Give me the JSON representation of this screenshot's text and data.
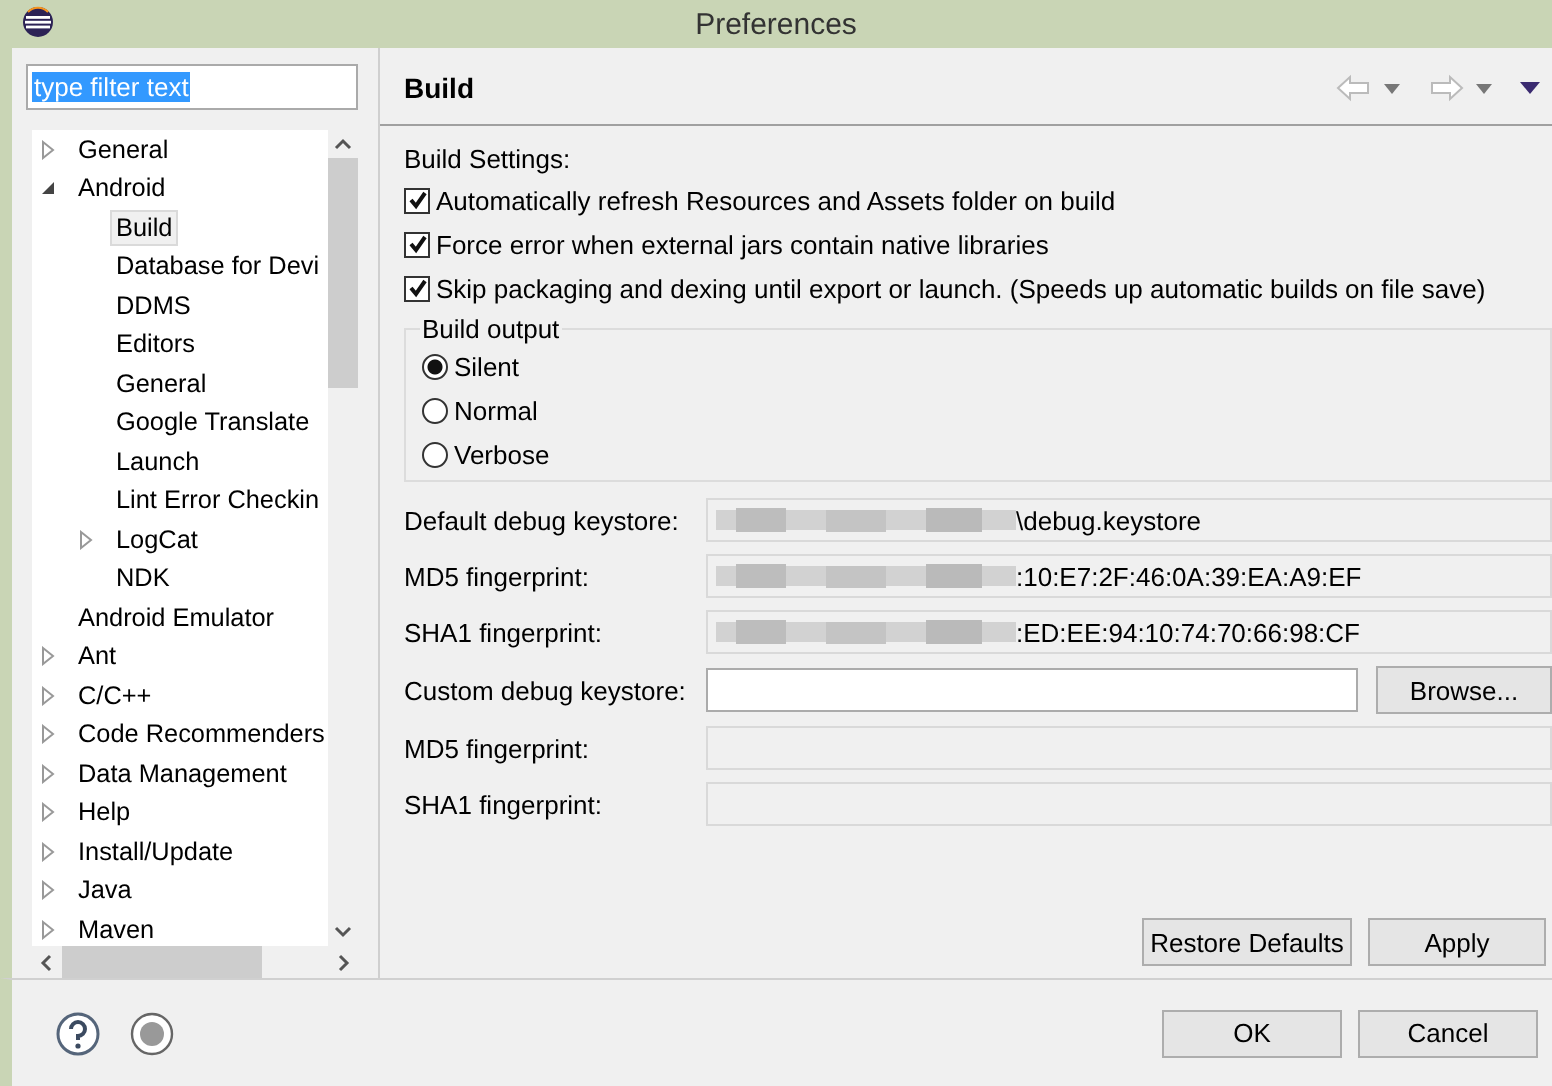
{
  "window": {
    "title": "Preferences"
  },
  "filter": {
    "value": "type filter text",
    "selected": true
  },
  "tree": [
    {
      "label": "General",
      "expanded": false,
      "selected": false
    },
    {
      "label": "Android",
      "expanded": true,
      "selected": false,
      "children": [
        {
          "label": "Build",
          "selected": true
        },
        {
          "label": "Database for Devi",
          "selected": false
        },
        {
          "label": "DDMS",
          "selected": false
        },
        {
          "label": "Editors",
          "selected": false
        },
        {
          "label": "General",
          "selected": false
        },
        {
          "label": "Google Translate",
          "selected": false
        },
        {
          "label": "Launch",
          "selected": false
        },
        {
          "label": "Lint Error Checkin",
          "selected": false
        },
        {
          "label": "LogCat",
          "expanded": false,
          "selected": false
        },
        {
          "label": "NDK",
          "selected": false
        }
      ]
    },
    {
      "label": "Android Emulator",
      "selected": false
    },
    {
      "label": "Ant",
      "expanded": false,
      "selected": false
    },
    {
      "label": "C/C++",
      "expanded": false,
      "selected": false
    },
    {
      "label": "Code Recommenders",
      "expanded": false,
      "selected": false
    },
    {
      "label": "Data Management",
      "expanded": false,
      "selected": false
    },
    {
      "label": "Help",
      "expanded": false,
      "selected": false
    },
    {
      "label": "Install/Update",
      "expanded": false,
      "selected": false
    },
    {
      "label": "Java",
      "expanded": false,
      "selected": false
    },
    {
      "label": "Maven",
      "expanded": false,
      "selected": false
    }
  ],
  "page": {
    "title": "Build",
    "settings_label": "Build Settings:",
    "checkboxes": [
      {
        "label": "Automatically refresh Resources and Assets folder on build",
        "checked": true
      },
      {
        "label": "Force error when external jars contain native libraries",
        "checked": true
      },
      {
        "label": "Skip packaging and dexing until export or launch. (Speeds up automatic builds on file save)",
        "checked": true
      }
    ],
    "build_output": {
      "title": "Build output",
      "options": [
        {
          "label": "Silent",
          "selected": true
        },
        {
          "label": "Normal",
          "selected": false
        },
        {
          "label": "Verbose",
          "selected": false
        }
      ]
    },
    "fields": [
      {
        "label": "Default debug keystore:",
        "value": "\\debug.keystore",
        "kind": "readonly",
        "blurred": true
      },
      {
        "label": "MD5 fingerprint:",
        "value": ":10:E7:2F:46:0A:39:EA:A9:EF",
        "kind": "readonly",
        "blurred": true
      },
      {
        "label": "SHA1 fingerprint:",
        "value": ":ED:EE:94:10:74:70:66:98:CF",
        "kind": "readonly",
        "blurred": true
      },
      {
        "label": "Custom debug keystore:",
        "kind": "editable",
        "button": "Browse..."
      },
      {
        "label": "MD5 fingerprint:",
        "kind": "readonly"
      },
      {
        "label": "SHA1 fingerprint:",
        "kind": "readonly"
      }
    ],
    "restore_button": "Restore Defaults",
    "apply_button": "Apply"
  },
  "buttons": [
    "OK",
    "Cancel"
  ]
}
